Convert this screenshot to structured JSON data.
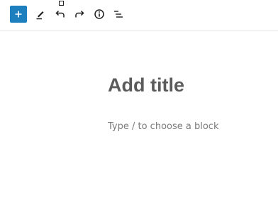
{
  "toolbar": {
    "inserter_icon": "plus-icon",
    "tools_icon": "pencil-icon",
    "undo_icon": "undo-icon",
    "redo_icon": "redo-icon",
    "details_icon": "info-icon",
    "outline_icon": "list-view-icon"
  },
  "colors": {
    "accent": "#1e7fbf",
    "title_text": "#5b5b5b",
    "placeholder_text": "#7a7a7a",
    "divider": "#e5e5e5"
  },
  "editor": {
    "title_placeholder": "Add title",
    "block_placeholder": "Type / to choose a block"
  }
}
